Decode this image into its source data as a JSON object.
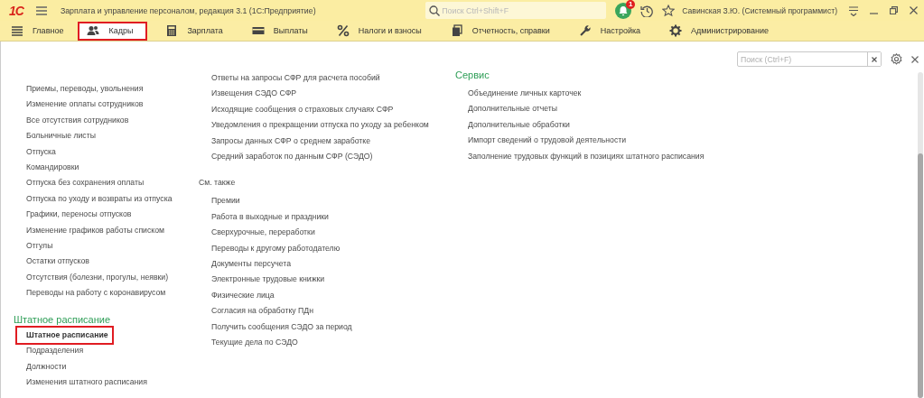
{
  "title_bar": {
    "logo": "1С",
    "title": "Зарплата и управление персоналом, редакция 3.1  (1С:Предприятие)",
    "search": {
      "placeholder": "Поиск Ctrl+Shift+F"
    },
    "notifications_badge": "1",
    "user": "Савинская З.Ю. (Системный программист)"
  },
  "sections": [
    {
      "label": "Главное",
      "selected": false
    },
    {
      "label": "Кадры",
      "selected": true
    },
    {
      "label": "Зарплата",
      "selected": false
    },
    {
      "label": "Выплаты",
      "selected": false
    },
    {
      "label": "Налоги и взносы",
      "selected": false
    },
    {
      "label": "Отчетность, справки",
      "selected": false
    },
    {
      "label": "Настройка",
      "selected": false
    },
    {
      "label": "Администрирование",
      "selected": false
    }
  ],
  "panel": {
    "search": {
      "placeholder": "Поиск (Ctrl+F)"
    },
    "column_1": {
      "items": [
        "Приемы, переводы, увольнения",
        "Изменение оплаты сотрудников",
        "Все отсутствия сотрудников",
        "Больничные листы",
        "Отпуска",
        "Командировки",
        "Отпуска без сохранения оплаты",
        "Отпуска по уходу и возвраты из отпуска",
        "Графики, переносы отпусков",
        "Изменение графиков работы списком",
        "Отгулы",
        "Остатки отпусков",
        "Отсутствия (болезни, прогулы, неявки)",
        "Переводы на работу с коронавирусом"
      ],
      "group": {
        "title": "Штатное расписание",
        "items": [
          {
            "label": "Штатное расписание",
            "bold": true,
            "highlighted": true
          },
          {
            "label": "Подразделения",
            "bold": false,
            "highlighted": false
          },
          {
            "label": "Должности",
            "bold": false,
            "highlighted": false
          },
          {
            "label": "Изменения штатного расписания",
            "bold": false,
            "highlighted": false
          }
        ]
      }
    },
    "column_2": {
      "items": [
        "Ответы на запросы СФР для расчета пособий",
        "Извещения СЭДО СФР",
        "Исходящие сообщения о страховых случаях СФР",
        "Уведомления о прекращении отпуска по уходу за ребенком",
        "Запросы данных СФР о среднем заработке",
        "Средний заработок по данным СФР (СЭДО)"
      ],
      "see_also": {
        "title": "См. также",
        "items": [
          "Премии",
          "Работа в выходные и праздники",
          "Сверхурочные, переработки",
          "Переводы к другому работодателю",
          "Документы персучета",
          "Электронные трудовые книжки",
          "Физические лица",
          "Согласия на обработку ПДн",
          "Получить сообщения СЭДО за период",
          "Текущие дела по СЭДО"
        ]
      }
    },
    "column_3": {
      "title": "Сервис",
      "items": [
        "Объединение личных карточек",
        "Дополнительные отчеты",
        "Дополнительные обработки",
        "Импорт сведений о трудовой деятельности",
        "Заполнение трудовых функций в позициях штатного расписания"
      ]
    }
  }
}
